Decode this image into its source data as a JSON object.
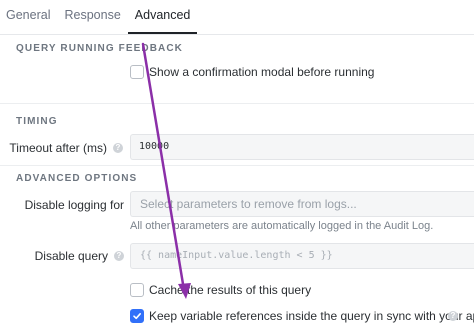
{
  "tabs": [
    {
      "label": "General"
    },
    {
      "label": "Response"
    },
    {
      "label": "Advanced"
    }
  ],
  "active_tab": "Advanced",
  "query_running_feedback": {
    "title": "QUERY RUNNING FEEDBACK",
    "confirmation_modal": {
      "label": "Show a confirmation modal before running",
      "checked": false
    }
  },
  "timing": {
    "title": "TIMING",
    "timeout_label": "Timeout after (ms)",
    "timeout_value": "10000"
  },
  "advanced_options": {
    "title": "ADVANCED OPTIONS",
    "disable_logging_label": "Disable logging for",
    "disable_logging_placeholder": "Select parameters to remove from logs...",
    "disable_logging_hint": "All other parameters are automatically logged in the Audit Log.",
    "disable_query_label": "Disable query",
    "disable_query_placeholder": "{{ nameInput.value.length < 5 }}",
    "cache_results": {
      "label": "Cache the results of this query",
      "checked": false
    },
    "keep_variable_refs": {
      "label": "Keep variable references inside the query in sync with your app.",
      "checked": true
    }
  },
  "colors": {
    "accent": "#3170f9",
    "annotation_arrow": "#8b2fa8"
  },
  "icons": {
    "help": "question-circle-icon",
    "check": "checkmark-icon"
  }
}
